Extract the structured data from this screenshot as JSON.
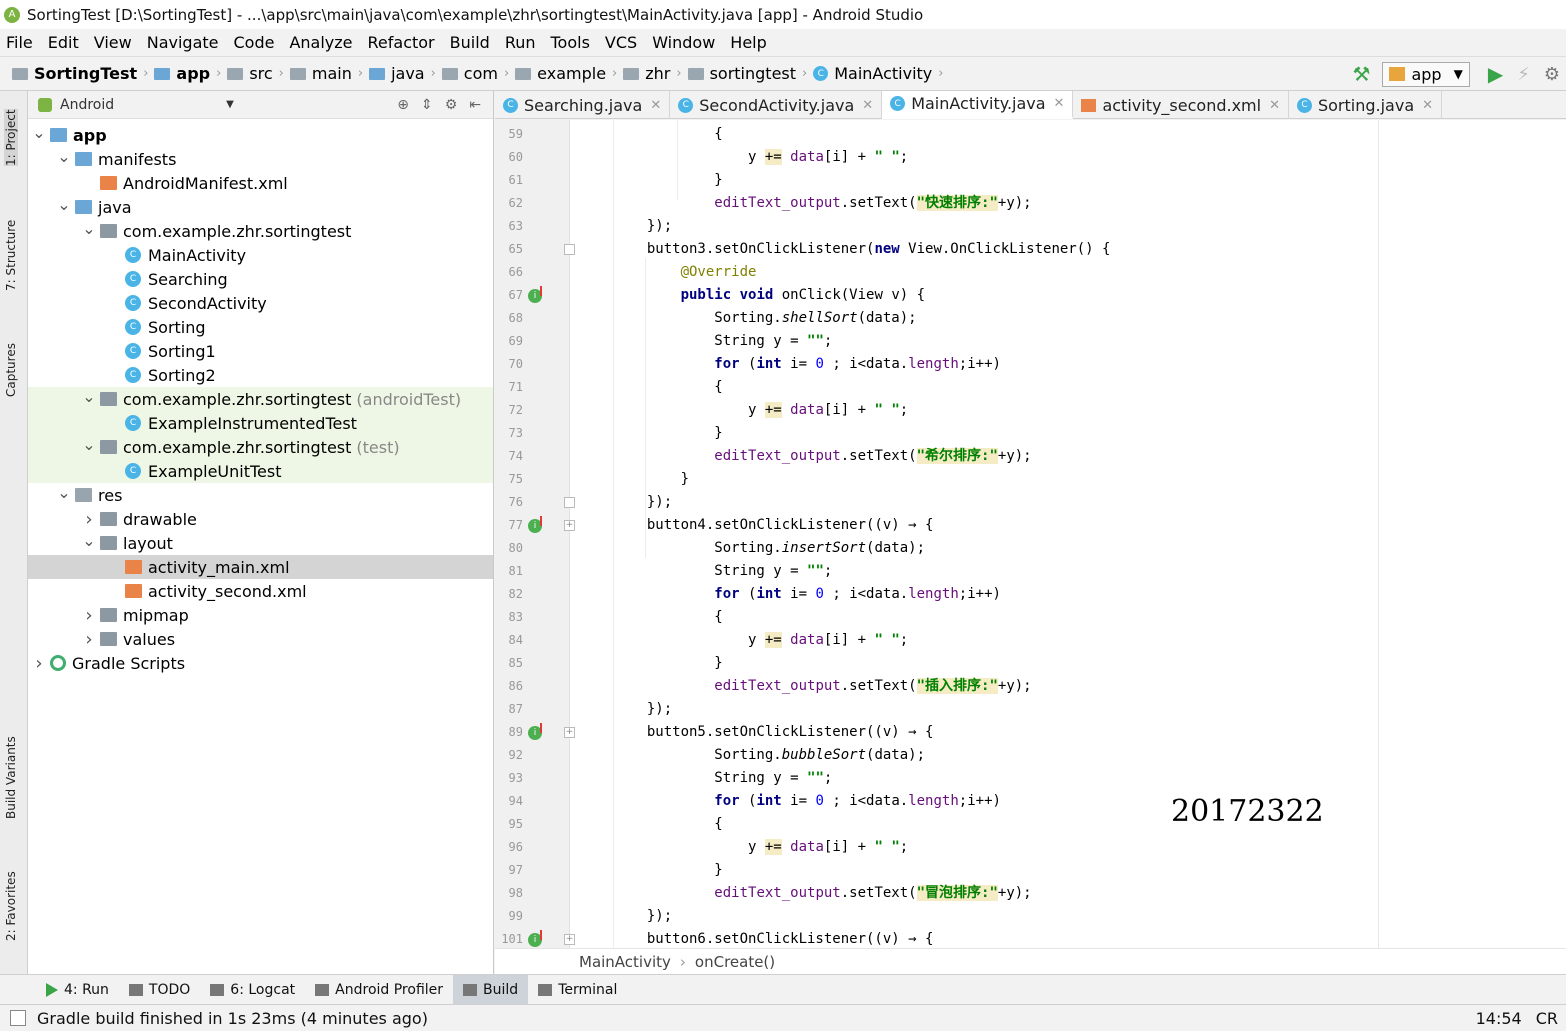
{
  "title": "SortingTest [D:\\SortingTest] - ...\\app\\src\\main\\java\\com\\example\\zhr\\sortingtest\\MainActivity.java [app] - Android Studio",
  "menu": [
    "File",
    "Edit",
    "View",
    "Navigate",
    "Code",
    "Analyze",
    "Refactor",
    "Build",
    "Run",
    "Tools",
    "VCS",
    "Window",
    "Help"
  ],
  "breadcrumbs": [
    "SortingTest",
    "app",
    "src",
    "main",
    "java",
    "com",
    "example",
    "zhr",
    "sortingtest",
    "MainActivity"
  ],
  "run_config": "app",
  "side_tabs": [
    "1: Project",
    "7: Structure",
    "Captures",
    "Build Variants",
    "2: Favorites"
  ],
  "project_panel": {
    "view": "Android",
    "tree": [
      {
        "label": "app",
        "muted": ""
      },
      {
        "label": "manifests",
        "muted": ""
      },
      {
        "label": "AndroidManifest.xml",
        "muted": ""
      },
      {
        "label": "java",
        "muted": ""
      },
      {
        "label": "com.example.zhr.sortingtest",
        "muted": ""
      },
      {
        "label": "MainActivity",
        "muted": ""
      },
      {
        "label": "Searching",
        "muted": ""
      },
      {
        "label": "SecondActivity",
        "muted": ""
      },
      {
        "label": "Sorting",
        "muted": ""
      },
      {
        "label": "Sorting1",
        "muted": ""
      },
      {
        "label": "Sorting2",
        "muted": ""
      },
      {
        "label": "com.example.zhr.sortingtest",
        "muted": "(androidTest)"
      },
      {
        "label": "ExampleInstrumentedTest",
        "muted": ""
      },
      {
        "label": "com.example.zhr.sortingtest",
        "muted": "(test)"
      },
      {
        "label": "ExampleUnitTest",
        "muted": ""
      },
      {
        "label": "res",
        "muted": ""
      },
      {
        "label": "drawable",
        "muted": ""
      },
      {
        "label": "layout",
        "muted": ""
      },
      {
        "label": "activity_main.xml",
        "muted": ""
      },
      {
        "label": "activity_second.xml",
        "muted": ""
      },
      {
        "label": "mipmap",
        "muted": ""
      },
      {
        "label": "values",
        "muted": ""
      },
      {
        "label": "Gradle Scripts",
        "muted": ""
      }
    ]
  },
  "tabs": [
    "Searching.java",
    "SecondActivity.java",
    "MainActivity.java",
    "activity_second.xml",
    "Sorting.java"
  ],
  "active_tab": "MainActivity.java",
  "line_numbers": [
    "59",
    "60",
    "61",
    "62",
    "63",
    "65",
    "66",
    "67",
    "68",
    "69",
    "70",
    "71",
    "72",
    "73",
    "74",
    "75",
    "76",
    "77",
    "80",
    "81",
    "82",
    "83",
    "84",
    "85",
    "86",
    "87",
    "89",
    "92",
    "93",
    "94",
    "95",
    "96",
    "97",
    "98",
    "99",
    "101"
  ],
  "code": {
    "quick": "\"快速排序:\"",
    "shell": "\"希尔排序:\"",
    "insert": "\"插入排序:\"",
    "bubble": "\"冒泡排序:\"",
    "empty": "\"\"",
    "space": "\" \"",
    "override": "@Override"
  },
  "watermark": "20172322",
  "editor_breadcrumb": [
    "MainActivity",
    "onCreate()"
  ],
  "bottom_tools": [
    "4: Run",
    "TODO",
    "6: Logcat",
    "Android Profiler",
    "Build",
    "Terminal"
  ],
  "status": {
    "message": "Gradle build finished in 1s 23ms (4 minutes ago)",
    "time": "14:54",
    "extra": "CR"
  }
}
